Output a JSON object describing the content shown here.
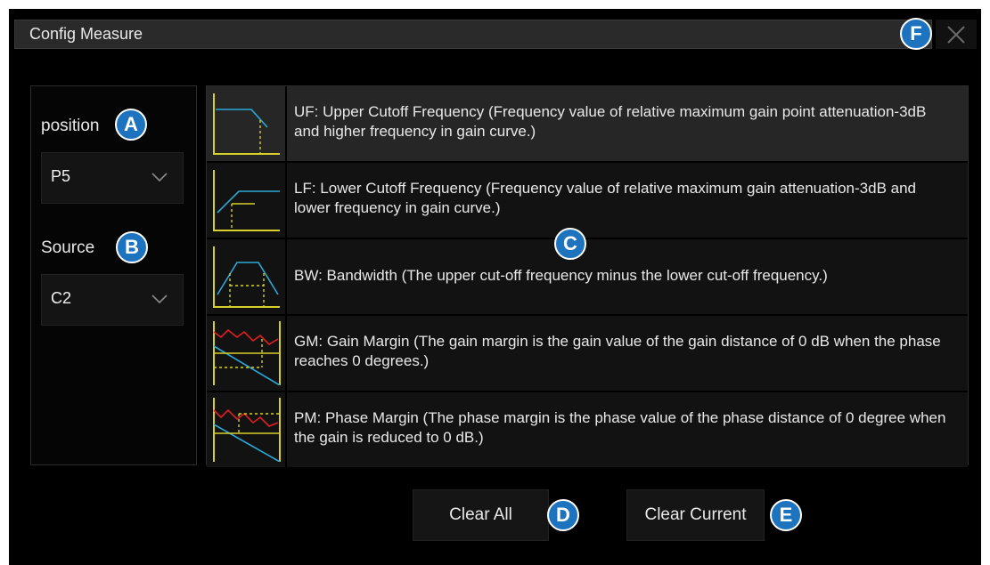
{
  "dialog": {
    "title": "Config Measure"
  },
  "badges": {
    "a": "A",
    "b": "B",
    "c": "C",
    "d": "D",
    "e": "E",
    "f": "F"
  },
  "left": {
    "position_label": "position",
    "position_value": "P5",
    "source_label": "Source",
    "source_value": "C2"
  },
  "items": [
    {
      "label": "UF: Upper Cutoff Frequency (Frequency value of relative maximum gain point attenuation-3dB and higher frequency in gain curve.)",
      "icon": "uf-curve-icon"
    },
    {
      "label": "LF: Lower Cutoff Frequency (Frequency value of relative maximum gain attenuation-3dB and lower frequency in gain curve.)",
      "icon": "lf-curve-icon"
    },
    {
      "label": "BW: Bandwidth (The upper cut-off frequency minus the lower cut-off frequency.)",
      "icon": "bw-curve-icon"
    },
    {
      "label": "GM: Gain Margin (The gain margin is the gain value of the gain distance of 0 dB when the phase reaches 0 degrees.)",
      "icon": "gm-curve-icon"
    },
    {
      "label": "PM: Phase Margin (The phase margin is the phase value of the phase distance of 0 degree when the gain is reduced to 0 dB.)",
      "icon": "pm-curve-icon"
    }
  ],
  "buttons": {
    "clear_all": "Clear All",
    "clear_current": "Clear Current"
  },
  "colors": {
    "curve": "#29a9d8",
    "axis": "#d8d02a",
    "red": "#e02020",
    "badge": "#1e73be",
    "selected_row": "#262626"
  }
}
